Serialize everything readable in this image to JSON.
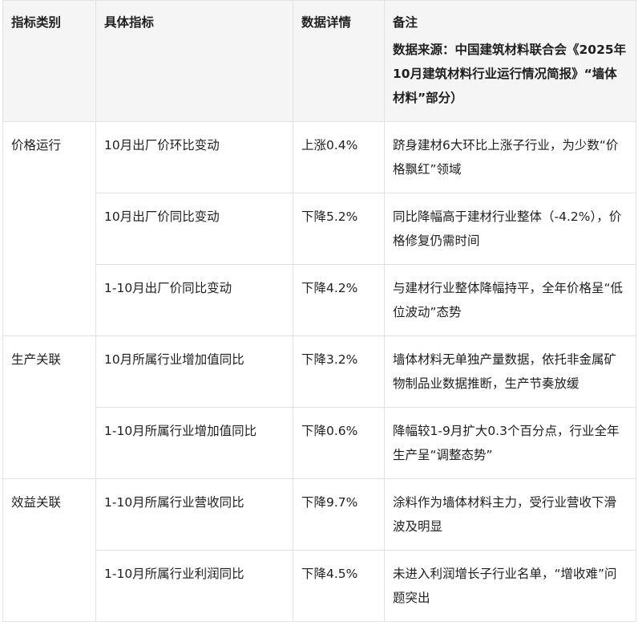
{
  "headers": {
    "category": "指标类别",
    "indicator": "具体指标",
    "detail": "数据详情",
    "note": "备注",
    "note_source": "数据来源：中国建筑材料联合会《2025年10月建筑材料行业运行情况简报》“墙体材料”部分）"
  },
  "rows": [
    {
      "category": "价格运行",
      "indicator": "10月出厂价环比变动",
      "detail": "上涨0.4%",
      "note": "跻身建材6大环比上涨子行业，为少数“价格飘红”领域"
    },
    {
      "category": "",
      "indicator": "10月出厂价同比变动",
      "detail": "下降5.2%",
      "note": "同比降幅高于建材行业整体（-4.2%），价格修复仍需时间"
    },
    {
      "category": "",
      "indicator": "1-10月出厂价同比变动",
      "detail": "下降4.2%",
      "note": "与建材行业整体降幅持平，全年价格呈“低位波动”态势"
    },
    {
      "category": "生产关联",
      "indicator": "10月所属行业增加值同比",
      "detail": "下降3.2%",
      "note": "墙体材料无单独产量数据，依托非金属矿物制品业数据推断，生产节奏放缓"
    },
    {
      "category": "",
      "indicator": "1-10月所属行业增加值同比",
      "detail": "下降0.6%",
      "note": "降幅较1-9月扩大0.3个百分点，行业全年生产呈“调整态势”"
    },
    {
      "category": "效益关联",
      "indicator": "1-10月所属行业营收同比",
      "detail": "下降9.7%",
      "note": "涂料作为墙体材料主力，受行业营收下滑波及明显"
    },
    {
      "category": "",
      "indicator": "1-10月所属行业利润同比",
      "detail": "下降4.5%",
      "note": "未进入利润增长子行业名单，“增收难”问题突出"
    }
  ]
}
